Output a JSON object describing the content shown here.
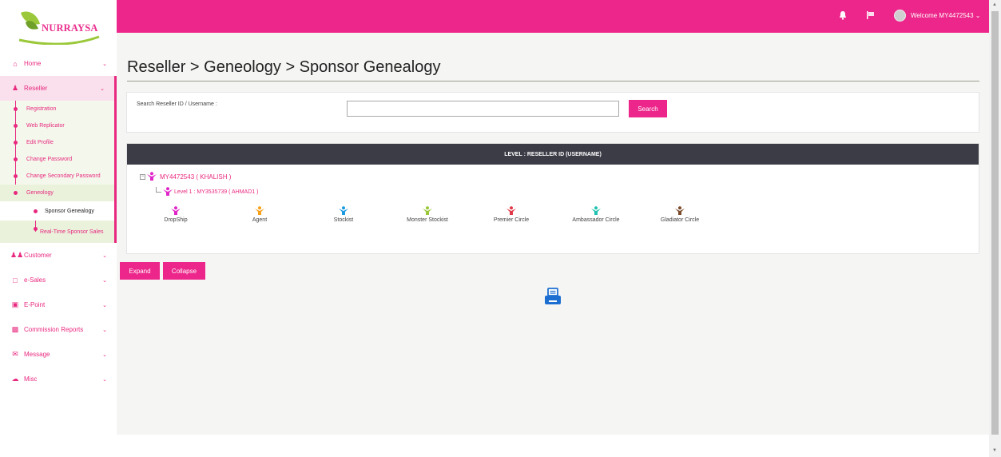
{
  "brand": {
    "name": "NURRAYSA"
  },
  "sidebar": {
    "items": [
      {
        "label": "Home",
        "icon": "home-icon"
      },
      {
        "label": "Reseller",
        "icon": "user-icon"
      },
      {
        "label": "Customer",
        "icon": "users-icon"
      },
      {
        "label": "e-Sales",
        "icon": "cart-icon"
      },
      {
        "label": "E-Point",
        "icon": "money-icon"
      },
      {
        "label": "Commission Reports",
        "icon": "files-icon"
      },
      {
        "label": "Message",
        "icon": "envelope-icon"
      },
      {
        "label": "Misc",
        "icon": "cloud-icon"
      }
    ],
    "reseller_sub": [
      "Registration",
      "Web Replicator",
      "Edit Profile",
      "Change Password",
      "Change Secondary Password",
      "Geneology"
    ],
    "geneology_sub": [
      "Sponsor Genealogy",
      "Real-Time Sponsor Sales"
    ]
  },
  "topbar": {
    "welcome": "Welcome MY4472543",
    "bell_icon": "bell-icon",
    "flag_icon": "flag-icon"
  },
  "page": {
    "title": "Reseller > Geneology > Sponsor Genealogy"
  },
  "search": {
    "label": "Search Reseller ID / Username :",
    "value": "",
    "button": "Search"
  },
  "tree": {
    "header": "LEVEL : RESELLER ID (USERNAME)",
    "root": "MY4472543 ( KHALISH )",
    "child": "Level 1 : MY3535739 ( AHMAD1 )",
    "root_color": "#e026c8",
    "child_color": "#e026c8"
  },
  "legend": [
    {
      "label": "DropShip",
      "color": "#e026c8"
    },
    {
      "label": "Agent",
      "color": "#f7a11a"
    },
    {
      "label": "Stockist",
      "color": "#1e9be0"
    },
    {
      "label": "Monster Stockist",
      "color": "#9bc83a"
    },
    {
      "label": "Premier Circle",
      "color": "#e03a4a"
    },
    {
      "label": "Ambassador Circle",
      "color": "#1fc2b0"
    },
    {
      "label": "Gladiator Circle",
      "color": "#7a4a2a"
    }
  ],
  "actions": {
    "expand": "Expand",
    "collapse": "Collapse",
    "print_icon": "printer-icon"
  },
  "colors": {
    "accent": "#ec268a",
    "header_dark": "#3b3c46"
  }
}
